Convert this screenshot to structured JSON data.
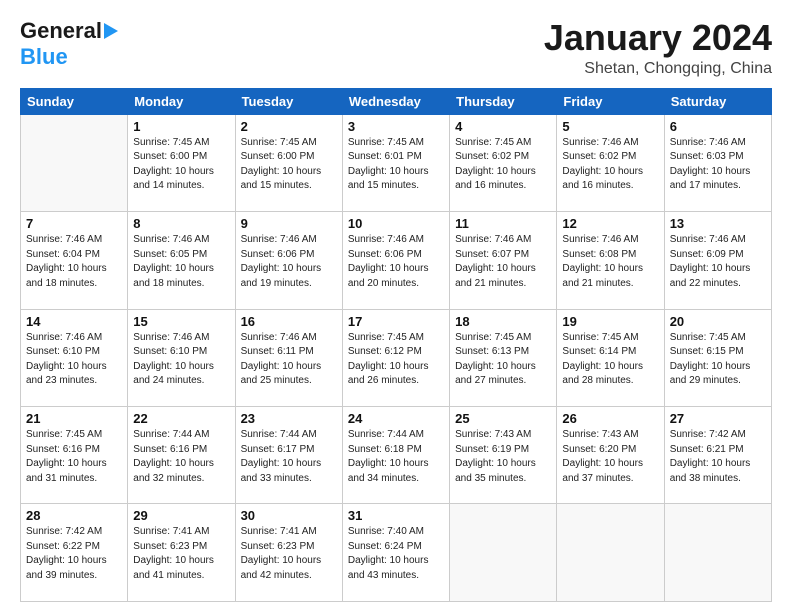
{
  "header": {
    "logo_general": "General",
    "logo_blue": "Blue",
    "month_title": "January 2024",
    "location": "Shetan, Chongqing, China"
  },
  "weekdays": [
    "Sunday",
    "Monday",
    "Tuesday",
    "Wednesday",
    "Thursday",
    "Friday",
    "Saturday"
  ],
  "weeks": [
    [
      {
        "day": "",
        "info": ""
      },
      {
        "day": "1",
        "info": "Sunrise: 7:45 AM\nSunset: 6:00 PM\nDaylight: 10 hours\nand 14 minutes."
      },
      {
        "day": "2",
        "info": "Sunrise: 7:45 AM\nSunset: 6:00 PM\nDaylight: 10 hours\nand 15 minutes."
      },
      {
        "day": "3",
        "info": "Sunrise: 7:45 AM\nSunset: 6:01 PM\nDaylight: 10 hours\nand 15 minutes."
      },
      {
        "day": "4",
        "info": "Sunrise: 7:45 AM\nSunset: 6:02 PM\nDaylight: 10 hours\nand 16 minutes."
      },
      {
        "day": "5",
        "info": "Sunrise: 7:46 AM\nSunset: 6:02 PM\nDaylight: 10 hours\nand 16 minutes."
      },
      {
        "day": "6",
        "info": "Sunrise: 7:46 AM\nSunset: 6:03 PM\nDaylight: 10 hours\nand 17 minutes."
      }
    ],
    [
      {
        "day": "7",
        "info": "Sunrise: 7:46 AM\nSunset: 6:04 PM\nDaylight: 10 hours\nand 18 minutes."
      },
      {
        "day": "8",
        "info": "Sunrise: 7:46 AM\nSunset: 6:05 PM\nDaylight: 10 hours\nand 18 minutes."
      },
      {
        "day": "9",
        "info": "Sunrise: 7:46 AM\nSunset: 6:06 PM\nDaylight: 10 hours\nand 19 minutes."
      },
      {
        "day": "10",
        "info": "Sunrise: 7:46 AM\nSunset: 6:06 PM\nDaylight: 10 hours\nand 20 minutes."
      },
      {
        "day": "11",
        "info": "Sunrise: 7:46 AM\nSunset: 6:07 PM\nDaylight: 10 hours\nand 21 minutes."
      },
      {
        "day": "12",
        "info": "Sunrise: 7:46 AM\nSunset: 6:08 PM\nDaylight: 10 hours\nand 21 minutes."
      },
      {
        "day": "13",
        "info": "Sunrise: 7:46 AM\nSunset: 6:09 PM\nDaylight: 10 hours\nand 22 minutes."
      }
    ],
    [
      {
        "day": "14",
        "info": "Sunrise: 7:46 AM\nSunset: 6:10 PM\nDaylight: 10 hours\nand 23 minutes."
      },
      {
        "day": "15",
        "info": "Sunrise: 7:46 AM\nSunset: 6:10 PM\nDaylight: 10 hours\nand 24 minutes."
      },
      {
        "day": "16",
        "info": "Sunrise: 7:46 AM\nSunset: 6:11 PM\nDaylight: 10 hours\nand 25 minutes."
      },
      {
        "day": "17",
        "info": "Sunrise: 7:45 AM\nSunset: 6:12 PM\nDaylight: 10 hours\nand 26 minutes."
      },
      {
        "day": "18",
        "info": "Sunrise: 7:45 AM\nSunset: 6:13 PM\nDaylight: 10 hours\nand 27 minutes."
      },
      {
        "day": "19",
        "info": "Sunrise: 7:45 AM\nSunset: 6:14 PM\nDaylight: 10 hours\nand 28 minutes."
      },
      {
        "day": "20",
        "info": "Sunrise: 7:45 AM\nSunset: 6:15 PM\nDaylight: 10 hours\nand 29 minutes."
      }
    ],
    [
      {
        "day": "21",
        "info": "Sunrise: 7:45 AM\nSunset: 6:16 PM\nDaylight: 10 hours\nand 31 minutes."
      },
      {
        "day": "22",
        "info": "Sunrise: 7:44 AM\nSunset: 6:16 PM\nDaylight: 10 hours\nand 32 minutes."
      },
      {
        "day": "23",
        "info": "Sunrise: 7:44 AM\nSunset: 6:17 PM\nDaylight: 10 hours\nand 33 minutes."
      },
      {
        "day": "24",
        "info": "Sunrise: 7:44 AM\nSunset: 6:18 PM\nDaylight: 10 hours\nand 34 minutes."
      },
      {
        "day": "25",
        "info": "Sunrise: 7:43 AM\nSunset: 6:19 PM\nDaylight: 10 hours\nand 35 minutes."
      },
      {
        "day": "26",
        "info": "Sunrise: 7:43 AM\nSunset: 6:20 PM\nDaylight: 10 hours\nand 37 minutes."
      },
      {
        "day": "27",
        "info": "Sunrise: 7:42 AM\nSunset: 6:21 PM\nDaylight: 10 hours\nand 38 minutes."
      }
    ],
    [
      {
        "day": "28",
        "info": "Sunrise: 7:42 AM\nSunset: 6:22 PM\nDaylight: 10 hours\nand 39 minutes."
      },
      {
        "day": "29",
        "info": "Sunrise: 7:41 AM\nSunset: 6:23 PM\nDaylight: 10 hours\nand 41 minutes."
      },
      {
        "day": "30",
        "info": "Sunrise: 7:41 AM\nSunset: 6:23 PM\nDaylight: 10 hours\nand 42 minutes."
      },
      {
        "day": "31",
        "info": "Sunrise: 7:40 AM\nSunset: 6:24 PM\nDaylight: 10 hours\nand 43 minutes."
      },
      {
        "day": "",
        "info": ""
      },
      {
        "day": "",
        "info": ""
      },
      {
        "day": "",
        "info": ""
      }
    ]
  ]
}
